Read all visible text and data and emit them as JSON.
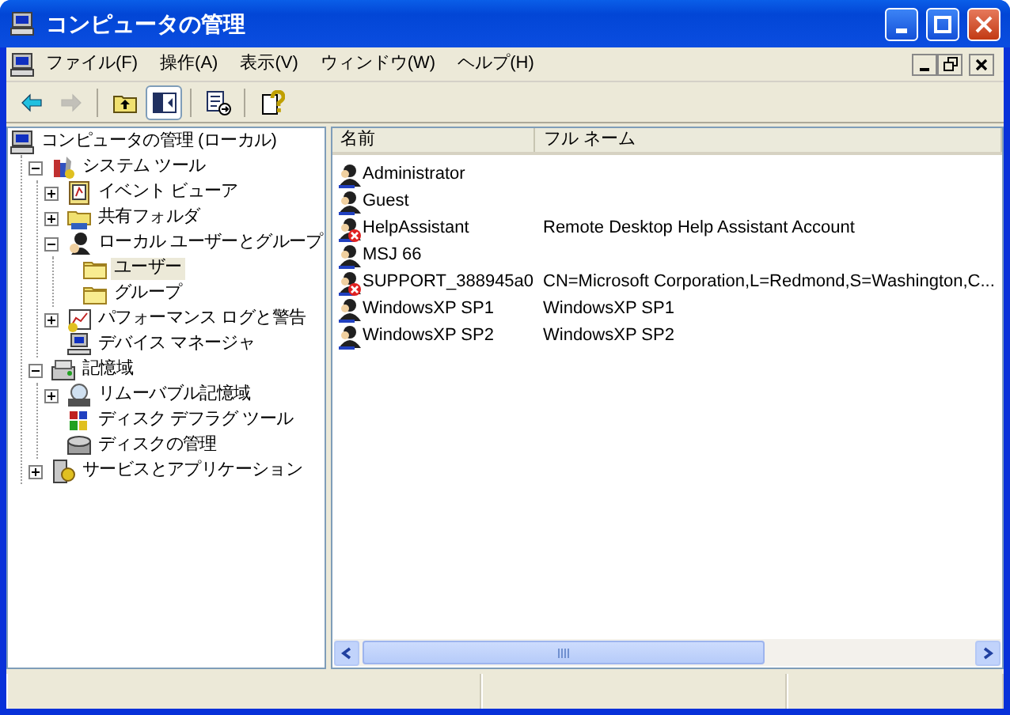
{
  "window": {
    "title": "コンピュータの管理"
  },
  "menu": [
    "ファイル(F)",
    "操作(A)",
    "表示(V)",
    "ウィンドウ(W)",
    "ヘルプ(H)"
  ],
  "toolbar": [
    {
      "kind": "back",
      "disabled": false
    },
    {
      "kind": "forward",
      "disabled": true
    },
    {
      "kind": "sep"
    },
    {
      "kind": "up"
    },
    {
      "kind": "tree",
      "pressed": true
    },
    {
      "kind": "sep"
    },
    {
      "kind": "export"
    },
    {
      "kind": "sep"
    },
    {
      "kind": "help"
    }
  ],
  "tree": [
    {
      "label": "コンピュータの管理 (ローカル)",
      "children": [
        {
          "label": "システム ツール",
          "expanded": true,
          "children": [
            {
              "label": "イベント ビューア",
              "expanded": false
            },
            {
              "label": "共有フォルダ",
              "expanded": false
            },
            {
              "label": "ローカル ユーザーとグループ",
              "expanded": true,
              "children": [
                {
                  "label": "ユーザー",
                  "selected": true
                },
                {
                  "label": "グループ",
                  "selected": false
                }
              ]
            },
            {
              "label": "パフォーマンス ログと警告",
              "expanded": false
            },
            {
              "label": "デバイス マネージャ"
            }
          ]
        },
        {
          "label": "記憶域",
          "expanded": true,
          "children": [
            {
              "label": "リムーバブル記憶域",
              "expanded": false
            },
            {
              "label": "ディスク デフラグ ツール"
            },
            {
              "label": "ディスクの管理"
            }
          ]
        },
        {
          "label": "サービスとアプリケーション",
          "expanded": false
        }
      ]
    }
  ],
  "list": {
    "columns": [
      "名前",
      "フル ネーム"
    ],
    "rows": [
      {
        "name": "Administrator",
        "disabled": false
      },
      {
        "name": "Guest",
        "disabled": false
      },
      {
        "name": "HelpAssistant",
        "full_name": "Remote Desktop Help Assistant Account",
        "disabled": true
      },
      {
        "name": "MSJ 66",
        "disabled": false
      },
      {
        "name": "SUPPORT_388945a0",
        "full_name": "CN=Microsoft Corporation,L=Redmond,S=Washington,C...",
        "disabled": true
      },
      {
        "name": "WindowsXP SP1",
        "full_name": "WindowsXP SP1",
        "disabled": false
      },
      {
        "name": "WindowsXP SP2",
        "full_name": "WindowsXP SP2",
        "disabled": false
      }
    ]
  }
}
